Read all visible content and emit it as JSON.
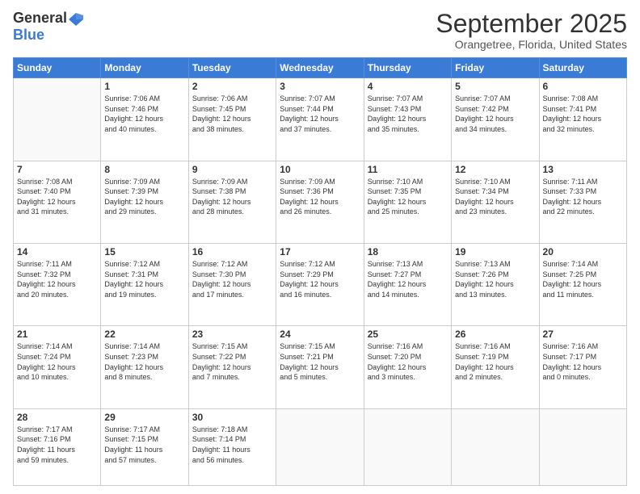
{
  "logo": {
    "general": "General",
    "blue": "Blue"
  },
  "header": {
    "title": "September 2025",
    "subtitle": "Orangetree, Florida, United States"
  },
  "weekdays": [
    "Sunday",
    "Monday",
    "Tuesday",
    "Wednesday",
    "Thursday",
    "Friday",
    "Saturday"
  ],
  "weeks": [
    [
      {
        "day": "",
        "info": ""
      },
      {
        "day": "1",
        "info": "Sunrise: 7:06 AM\nSunset: 7:46 PM\nDaylight: 12 hours\nand 40 minutes."
      },
      {
        "day": "2",
        "info": "Sunrise: 7:06 AM\nSunset: 7:45 PM\nDaylight: 12 hours\nand 38 minutes."
      },
      {
        "day": "3",
        "info": "Sunrise: 7:07 AM\nSunset: 7:44 PM\nDaylight: 12 hours\nand 37 minutes."
      },
      {
        "day": "4",
        "info": "Sunrise: 7:07 AM\nSunset: 7:43 PM\nDaylight: 12 hours\nand 35 minutes."
      },
      {
        "day": "5",
        "info": "Sunrise: 7:07 AM\nSunset: 7:42 PM\nDaylight: 12 hours\nand 34 minutes."
      },
      {
        "day": "6",
        "info": "Sunrise: 7:08 AM\nSunset: 7:41 PM\nDaylight: 12 hours\nand 32 minutes."
      }
    ],
    [
      {
        "day": "7",
        "info": "Sunrise: 7:08 AM\nSunset: 7:40 PM\nDaylight: 12 hours\nand 31 minutes."
      },
      {
        "day": "8",
        "info": "Sunrise: 7:09 AM\nSunset: 7:39 PM\nDaylight: 12 hours\nand 29 minutes."
      },
      {
        "day": "9",
        "info": "Sunrise: 7:09 AM\nSunset: 7:38 PM\nDaylight: 12 hours\nand 28 minutes."
      },
      {
        "day": "10",
        "info": "Sunrise: 7:09 AM\nSunset: 7:36 PM\nDaylight: 12 hours\nand 26 minutes."
      },
      {
        "day": "11",
        "info": "Sunrise: 7:10 AM\nSunset: 7:35 PM\nDaylight: 12 hours\nand 25 minutes."
      },
      {
        "day": "12",
        "info": "Sunrise: 7:10 AM\nSunset: 7:34 PM\nDaylight: 12 hours\nand 23 minutes."
      },
      {
        "day": "13",
        "info": "Sunrise: 7:11 AM\nSunset: 7:33 PM\nDaylight: 12 hours\nand 22 minutes."
      }
    ],
    [
      {
        "day": "14",
        "info": "Sunrise: 7:11 AM\nSunset: 7:32 PM\nDaylight: 12 hours\nand 20 minutes."
      },
      {
        "day": "15",
        "info": "Sunrise: 7:12 AM\nSunset: 7:31 PM\nDaylight: 12 hours\nand 19 minutes."
      },
      {
        "day": "16",
        "info": "Sunrise: 7:12 AM\nSunset: 7:30 PM\nDaylight: 12 hours\nand 17 minutes."
      },
      {
        "day": "17",
        "info": "Sunrise: 7:12 AM\nSunset: 7:29 PM\nDaylight: 12 hours\nand 16 minutes."
      },
      {
        "day": "18",
        "info": "Sunrise: 7:13 AM\nSunset: 7:27 PM\nDaylight: 12 hours\nand 14 minutes."
      },
      {
        "day": "19",
        "info": "Sunrise: 7:13 AM\nSunset: 7:26 PM\nDaylight: 12 hours\nand 13 minutes."
      },
      {
        "day": "20",
        "info": "Sunrise: 7:14 AM\nSunset: 7:25 PM\nDaylight: 12 hours\nand 11 minutes."
      }
    ],
    [
      {
        "day": "21",
        "info": "Sunrise: 7:14 AM\nSunset: 7:24 PM\nDaylight: 12 hours\nand 10 minutes."
      },
      {
        "day": "22",
        "info": "Sunrise: 7:14 AM\nSunset: 7:23 PM\nDaylight: 12 hours\nand 8 minutes."
      },
      {
        "day": "23",
        "info": "Sunrise: 7:15 AM\nSunset: 7:22 PM\nDaylight: 12 hours\nand 7 minutes."
      },
      {
        "day": "24",
        "info": "Sunrise: 7:15 AM\nSunset: 7:21 PM\nDaylight: 12 hours\nand 5 minutes."
      },
      {
        "day": "25",
        "info": "Sunrise: 7:16 AM\nSunset: 7:20 PM\nDaylight: 12 hours\nand 3 minutes."
      },
      {
        "day": "26",
        "info": "Sunrise: 7:16 AM\nSunset: 7:19 PM\nDaylight: 12 hours\nand 2 minutes."
      },
      {
        "day": "27",
        "info": "Sunrise: 7:16 AM\nSunset: 7:17 PM\nDaylight: 12 hours\nand 0 minutes."
      }
    ],
    [
      {
        "day": "28",
        "info": "Sunrise: 7:17 AM\nSunset: 7:16 PM\nDaylight: 11 hours\nand 59 minutes."
      },
      {
        "day": "29",
        "info": "Sunrise: 7:17 AM\nSunset: 7:15 PM\nDaylight: 11 hours\nand 57 minutes."
      },
      {
        "day": "30",
        "info": "Sunrise: 7:18 AM\nSunset: 7:14 PM\nDaylight: 11 hours\nand 56 minutes."
      },
      {
        "day": "",
        "info": ""
      },
      {
        "day": "",
        "info": ""
      },
      {
        "day": "",
        "info": ""
      },
      {
        "day": "",
        "info": ""
      }
    ]
  ]
}
